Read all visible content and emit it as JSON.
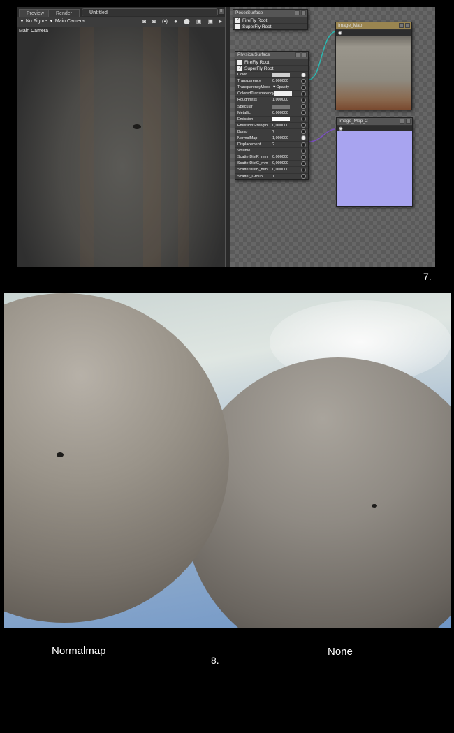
{
  "viewport": {
    "tabs": [
      "Preview",
      "Render",
      "Untitled"
    ],
    "figure_dropdown": "No Figure",
    "camera_dropdown": "Main Camera",
    "camera_label": "Main Camera"
  },
  "nodes": {
    "poser_surface": {
      "title": "PoserSurface",
      "rows": [
        {
          "label": "FireFly Root",
          "checked": true
        },
        {
          "label": "SuperFly Root",
          "checked": false
        }
      ]
    },
    "physical_surface": {
      "title": "PhysicalSurface",
      "roots": [
        {
          "label": "FireFly Root",
          "checked": false
        },
        {
          "label": "SuperFly Root",
          "checked": true
        }
      ],
      "params": [
        {
          "label": "Color",
          "value": "",
          "swatch": "#d0d0d0",
          "linked": true
        },
        {
          "label": "Transparency",
          "value": "0,000000"
        },
        {
          "label": "TransparencyMode",
          "value": "▼Opacity"
        },
        {
          "label": "ColoredTransparency",
          "value": "",
          "swatch": "#eeeeee"
        },
        {
          "label": "Roughness",
          "value": "1,000000"
        },
        {
          "label": "Specular",
          "value": "",
          "swatch": "#777777"
        },
        {
          "label": "Metallic",
          "value": "0,000000"
        },
        {
          "label": "Emission",
          "value": "",
          "swatch": "#ffffff"
        },
        {
          "label": "EmissionStrength",
          "value": "0,000000"
        },
        {
          "label": "Bump",
          "value": "?"
        },
        {
          "label": "NormalMap",
          "value": "1,000000",
          "linked": true
        },
        {
          "label": "Displacement",
          "value": "?"
        },
        {
          "label": "Volume",
          "value": ""
        },
        {
          "label": "ScatterDistR_mm",
          "value": "0,000000"
        },
        {
          "label": "ScatterDistG_mm",
          "value": "0,000000"
        },
        {
          "label": "ScatterDistB_mm",
          "value": "0,000000"
        },
        {
          "label": "Scatter_Group",
          "value": "1"
        }
      ]
    },
    "image_map": {
      "title": "Image_Map"
    },
    "image_map_2": {
      "title": "Image_Map_2"
    }
  },
  "captions": {
    "fig7": "7.",
    "fig8": "8.",
    "left": "Normalmap",
    "right": "None"
  }
}
